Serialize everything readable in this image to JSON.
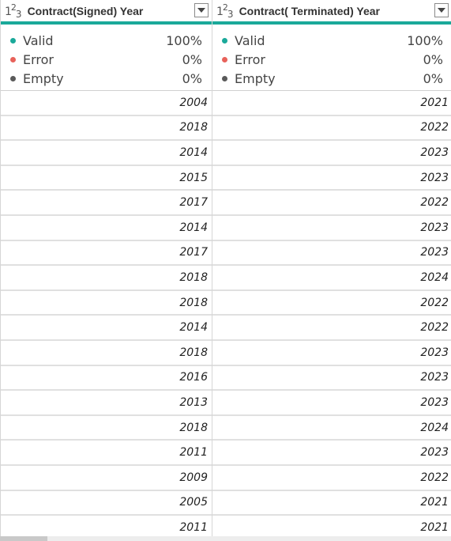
{
  "columns": [
    {
      "type_icon": {
        "a": "1",
        "b": "2",
        "c": "3"
      },
      "title": "Contract(Signed) Year",
      "quality": [
        {
          "label": "Valid",
          "value": "100%",
          "color": "#1aa99a"
        },
        {
          "label": "Error",
          "value": "0%",
          "color": "#e8625a"
        },
        {
          "label": "Empty",
          "value": "0%",
          "color": "#5a5a5a"
        }
      ],
      "rows": [
        "2004",
        "2018",
        "2014",
        "2015",
        "2017",
        "2014",
        "2017",
        "2018",
        "2018",
        "2014",
        "2018",
        "2016",
        "2013",
        "2018",
        "2011",
        "2009",
        "2005",
        "2011"
      ]
    },
    {
      "type_icon": {
        "a": "1",
        "b": "2",
        "c": "3"
      },
      "title": "Contract( Terminated) Year",
      "quality": [
        {
          "label": "Valid",
          "value": "100%",
          "color": "#1aa99a"
        },
        {
          "label": "Error",
          "value": "0%",
          "color": "#e8625a"
        },
        {
          "label": "Empty",
          "value": "0%",
          "color": "#5a5a5a"
        }
      ],
      "rows": [
        "2021",
        "2022",
        "2023",
        "2023",
        "2022",
        "2023",
        "2023",
        "2024",
        "2022",
        "2022",
        "2023",
        "2023",
        "2023",
        "2024",
        "2023",
        "2022",
        "2021",
        "2021"
      ]
    }
  ],
  "icons": {
    "type": "whole-number-type-icon",
    "dropdown": "chevron-down-icon"
  }
}
